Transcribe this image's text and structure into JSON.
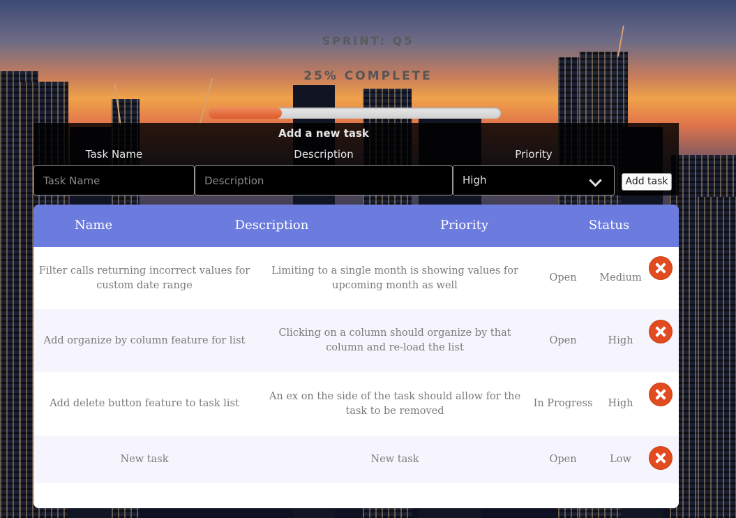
{
  "sprint": {
    "title": "SPRINT: Q5",
    "progress_label": "25% COMPLETE",
    "progress_fraction": 0.25
  },
  "form": {
    "title": "Add a new task",
    "labels": {
      "name": "Task Name",
      "description": "Description",
      "priority": "Priority"
    },
    "placeholders": {
      "name": "Task Name",
      "description": "Description"
    },
    "priority_selected": "High",
    "add_button": "Add task"
  },
  "table": {
    "headers": {
      "name": "Name",
      "description": "Description",
      "priority": "Priority",
      "status": "Status"
    },
    "rows": [
      {
        "name": "Filter calls returning incorrect values for custom date range",
        "description": "Limiting to a single month is showing values for upcoming month as well",
        "priority": "Open",
        "status": "Medium"
      },
      {
        "name": "Add organize by column feature for list",
        "description": "Clicking on a column should organize by that column and re-load the list",
        "priority": "Open",
        "status": "High"
      },
      {
        "name": "Add delete button feature to task list",
        "description": "An ex on the side of the task should allow for the task to be removed",
        "priority": "In Progress",
        "status": "High"
      },
      {
        "name": "New task",
        "description": "New task",
        "priority": "Open",
        "status": "Low"
      }
    ]
  },
  "colors": {
    "header": "#6c7bde",
    "progress": "#e56a3a",
    "delete": "#e24a1f"
  },
  "icons": {
    "delete": "close-circle-icon",
    "select": "chevron-down-icon"
  }
}
